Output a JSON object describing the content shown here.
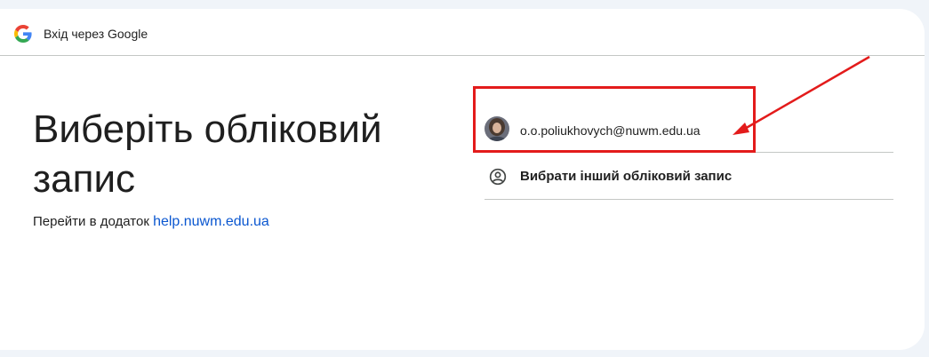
{
  "header": {
    "title": "Вхід через Google",
    "logo_icon": "google-g-logo"
  },
  "main": {
    "title": "Виберіть обліковий запис",
    "subtitle_prefix": "Перейти в додаток",
    "app_link": "help.nuwm.edu.ua"
  },
  "accounts": [
    {
      "email": "o.o.poliukhovych@nuwm.edu.ua",
      "avatar_icon": "user-photo-avatar"
    }
  ],
  "other_account": {
    "label": "Вибрати інший обліковий запис",
    "icon": "account-circle-icon"
  },
  "annotation": {
    "color": "#e31b1b"
  },
  "colors": {
    "link": "#0b57d0",
    "divider": "#c4c7c5",
    "background": "#f0f4f9"
  }
}
